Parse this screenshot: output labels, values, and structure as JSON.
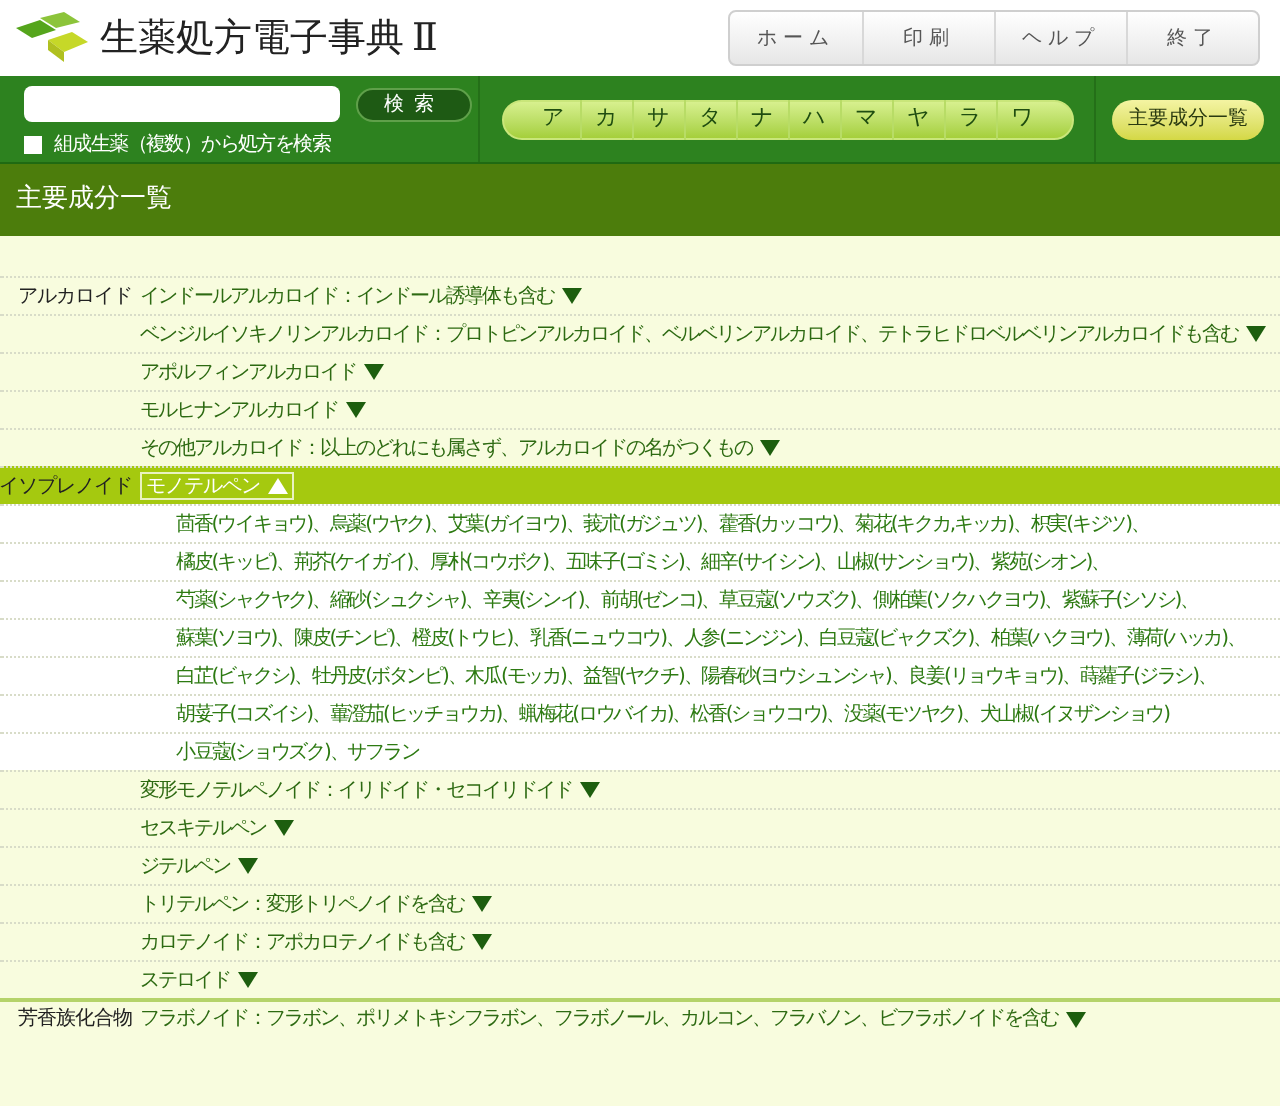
{
  "header": {
    "title": "生薬処方電子事典",
    "title_suffix": "Ⅱ",
    "buttons": [
      "ホーム",
      "印刷",
      "ヘルプ",
      "終了"
    ]
  },
  "search": {
    "button": "検索",
    "checkbox": {
      "label": "組成生薬（複数）から処方を検索",
      "checked": false
    }
  },
  "kana_tabs": [
    "ア",
    "カ",
    "サ",
    "タ",
    "ナ",
    "ハ",
    "マ",
    "ヤ",
    "ラ",
    "ワ"
  ],
  "list_button": "主要成分一覧",
  "page_title": "主要成分一覧",
  "categories": [
    {
      "label": "アルカロイド",
      "items": [
        {
          "label": "インドールアルカロイド：インドール誘導体も含む",
          "expanded": false
        },
        {
          "label": "ベンジルイソキノリンアルカロイド：プロトピンアルカロイド、ベルベリンアルカロイド、テトラヒドロベルベリンアルカロイドも含む",
          "expanded": false
        },
        {
          "label": "アポルフィンアルカロイド",
          "expanded": false
        },
        {
          "label": "モルヒナンアルカロイド",
          "expanded": false
        },
        {
          "label": "その他アルカロイド：以上のどれにも属さず、アルカロイドの名がつくもの",
          "expanded": false
        }
      ]
    },
    {
      "label": "イソプレノイド",
      "items": [
        {
          "label": "モノテルペン",
          "expanded": true,
          "herb_lines": [
            "茴香(ウイキョウ)、烏薬(ウヤク)、艾葉(ガイヨウ)、莪朮(ガジュツ)、藿香(カッコウ)、菊花(キクカ,キッカ)、枳実(キジツ)、",
            "橘皮(キッピ)、荊芥(ケイガイ)、厚朴(コウボク)、五味子(ゴミシ)、細辛(サイシン)、山椒(サンショウ)、紫苑(シオン)、",
            "芍薬(シャクヤク)、縮砂(シュクシャ)、辛夷(シンイ)、前胡(ゼンコ)、草豆蔻(ソウズク)、側柏葉(ソクハクヨウ)、紫蘇子(シソシ)、",
            "蘇葉(ソヨウ)、陳皮(チンピ)、橙皮(トウヒ)、乳香(ニュウコウ)、人参(ニンジン)、白豆蔻(ビャクズク)、柏葉(ハクヨウ)、薄荷(ハッカ)、",
            "白芷(ビャクシ)、牡丹皮(ボタンピ)、木瓜(モッカ)、益智(ヤクチ)、陽春砂(ヨウシュンシャ)、良姜(リョウキョウ)、蒔蘿子(ジラシ)、",
            "胡荽子(コズイシ)、蓽澄茄(ヒッチョウカ)、蝋梅花(ロウバイカ)、松香(ショウコウ)、没薬(モツヤク)、犬山椒(イヌザンショウ)",
            "小豆蔻(ショウズク)、サフラン"
          ]
        },
        {
          "label": "変形モノテルペノイド：イリドイド・セコイリドイド",
          "expanded": false
        },
        {
          "label": "セスキテルペン",
          "expanded": false
        },
        {
          "label": "ジテルペン",
          "expanded": false
        },
        {
          "label": "トリテルペン：変形トリペノイドを含む",
          "expanded": false
        },
        {
          "label": "カロテノイド：アポカロテノイドも含む",
          "expanded": false
        },
        {
          "label": "ステロイド",
          "expanded": false
        }
      ]
    },
    {
      "label": "芳香族化合物",
      "items": [
        {
          "label": "フラボノイド：フラボン、ポリメトキシフラボン、フラボノール、カルコン、フラバノン、ビフラボノイドを含む",
          "expanded": false
        }
      ]
    }
  ]
}
